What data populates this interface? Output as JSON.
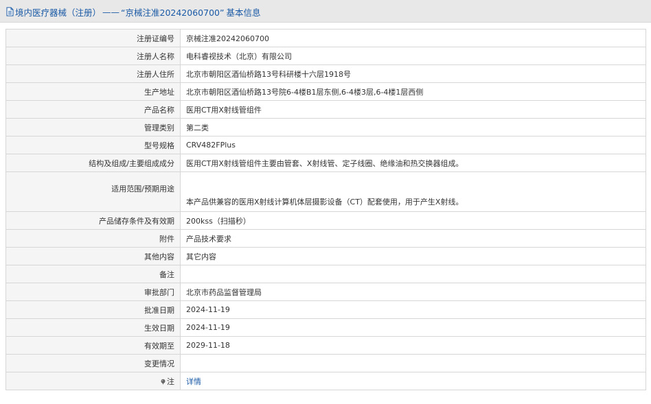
{
  "header": {
    "category": "境内医疗器械（注册）",
    "separator": "——",
    "quoted_title": "“京械注准20242060700”",
    "suffix": "基本信息"
  },
  "rows": [
    {
      "label": "注册证编号",
      "value": "京械注准20242060700"
    },
    {
      "label": "注册人名称",
      "value": "电科睿视技术（北京）有限公司"
    },
    {
      "label": "注册人住所",
      "value": "北京市朝阳区酒仙桥路13号科研楼十六层1918号"
    },
    {
      "label": "生产地址",
      "value": "北京市朝阳区酒仙桥路13号院6-4楼B1层东侧,6-4楼3层,6-4楼1层西侧"
    },
    {
      "label": "产品名称",
      "value": "医用CT用X射线管组件"
    },
    {
      "label": "管理类别",
      "value": "第二类"
    },
    {
      "label": "型号规格",
      "value": "CRV482FPlus"
    },
    {
      "label": "结构及组成/主要组成成分",
      "value": "医用CT用X射线管组件主要由管套、X射线管、定子线圈、绝缘油和热交换器组成。"
    },
    {
      "label": "适用范围/预期用途",
      "value": "本产品供兼容的医用X射线计算机体层摄影设备（CT）配套使用，用于产生X射线。"
    },
    {
      "label": "产品储存条件及有效期",
      "value": "200kss（扫描秒）"
    },
    {
      "label": "附件",
      "value": "产品技术要求"
    },
    {
      "label": "其他内容",
      "value": "其它内容"
    },
    {
      "label": "备注",
      "value": ""
    },
    {
      "label": "审批部门",
      "value": "北京市药品监督管理局"
    },
    {
      "label": "批准日期",
      "value": "2024-11-19"
    },
    {
      "label": "生效日期",
      "value": "2024-11-19"
    },
    {
      "label": "有效期至",
      "value": "2029-11-18"
    },
    {
      "label": "变更情况",
      "value": ""
    },
    {
      "label": "注",
      "value": "详情"
    }
  ],
  "icons": {
    "header_icon": "document-icon",
    "note_icon": "pin-icon"
  },
  "colors": {
    "link": "#1a5aa6",
    "header_bg": "#e8e8e8",
    "label_bg": "#f5f5f5",
    "border": "#d6d6d6"
  }
}
